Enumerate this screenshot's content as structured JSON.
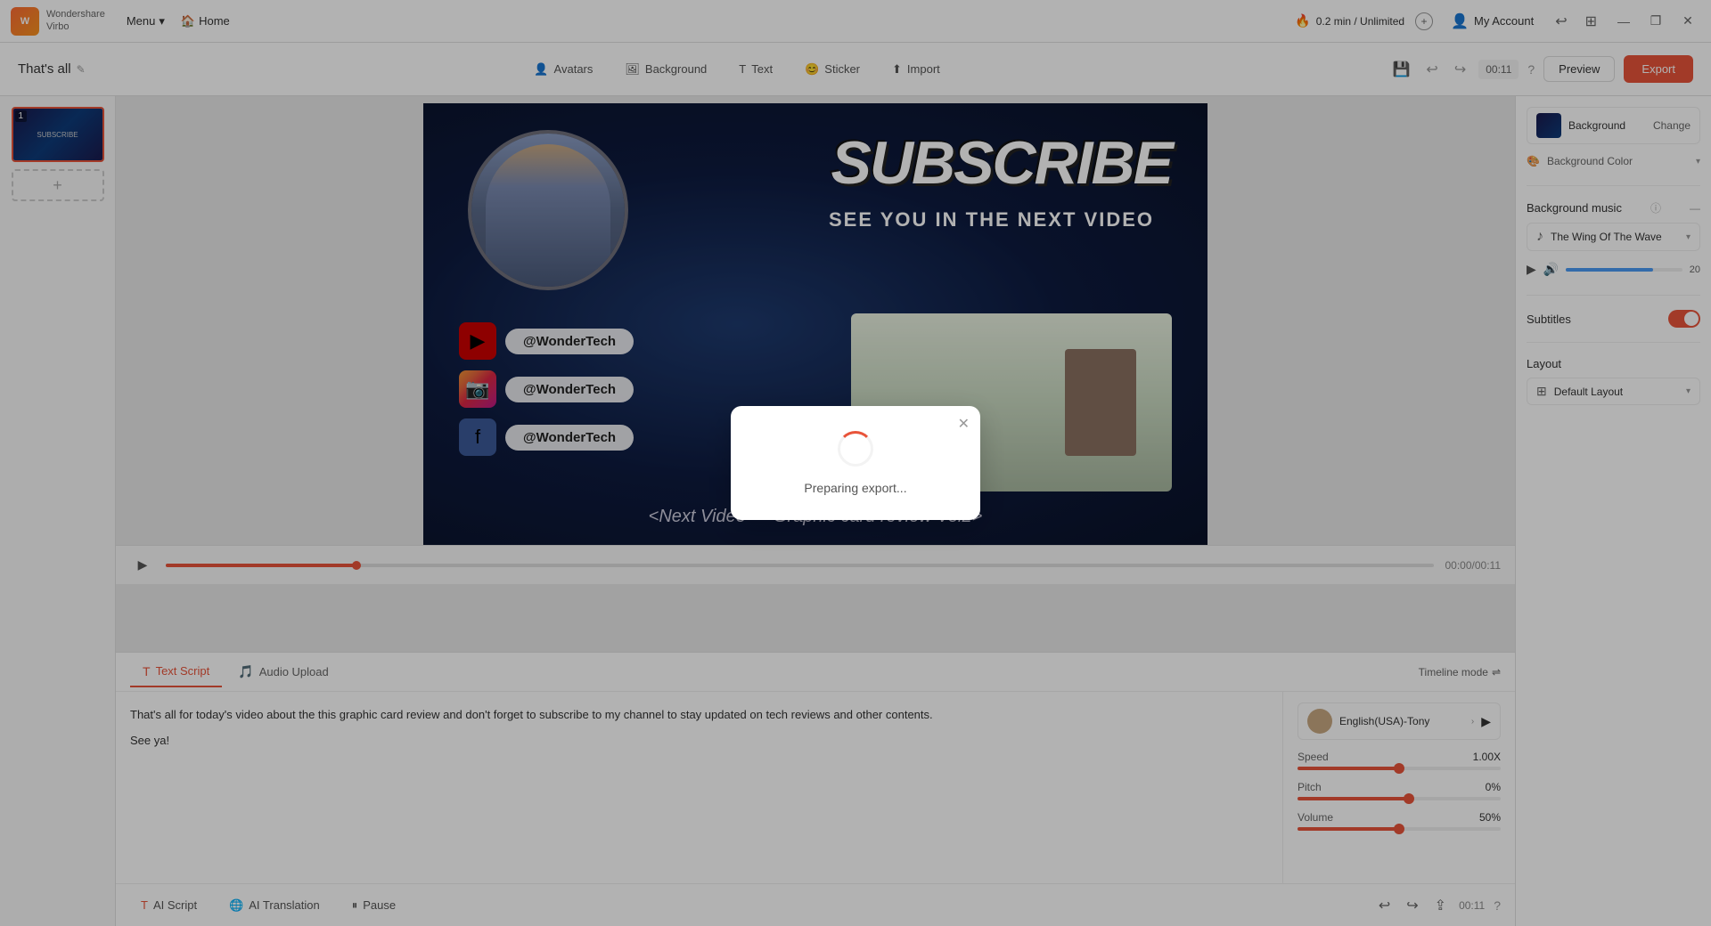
{
  "app": {
    "logo_line1": "Wondershare",
    "logo_line2": "Virbo"
  },
  "topbar": {
    "menu_label": "Menu",
    "home_label": "Home",
    "time_info": "0.2 min / Unlimited",
    "my_account": "My Account",
    "fire_icon": "🔥",
    "plus_label": "+",
    "minimize_label": "—",
    "maximize_label": "❐",
    "close_label": "✕"
  },
  "toolbar": {
    "slide_title": "That's all",
    "edit_icon": "✏️",
    "avatars_label": "Avatars",
    "background_label": "Background",
    "text_label": "Text",
    "sticker_label": "Sticker",
    "import_label": "Import",
    "undo_label": "↩",
    "redo_label": "↪",
    "time_display": "00:11",
    "preview_label": "Preview",
    "export_label": "Export"
  },
  "canvas": {
    "subscribe_text": "SUBSCRIBE",
    "subtitle_text": "SEE YOU IN THE NEXT VIDEO",
    "social_names": [
      "@WonderTech",
      "@WonderTech",
      "@WonderTech"
    ],
    "next_video_text": "<Next Video — Graphic card review Vol2>"
  },
  "timeline": {
    "time_current": "00:00",
    "time_total": "00:11",
    "progress_percent": 15
  },
  "script": {
    "tab_script": "Text Script",
    "tab_audio": "Audio Upload",
    "timeline_mode": "Timeline mode",
    "script_content": "That's all for today's video about the this graphic card review and don't forget to subscribe to my channel to stay updated on tech reviews and other contents.\nSee ya!",
    "voice_name": "English(USA)-Tony",
    "speed_label": "Speed",
    "speed_value": "1.00X",
    "pitch_label": "Pitch",
    "pitch_value": "0%",
    "volume_label": "Volume",
    "volume_value": "50%",
    "ai_script_label": "AI Script",
    "ai_translation_label": "AI Translation",
    "pause_label": "Pause",
    "time_code": "00:11"
  },
  "right_panel": {
    "background_label": "Background",
    "change_label": "Change",
    "bg_color_label": "Background Color",
    "bg_music_label": "Background music",
    "music_name": "The Wing Of The Wave",
    "volume_value": "20",
    "subtitles_label": "Subtitles",
    "layout_label": "Layout",
    "layout_name": "Default Layout"
  },
  "modal": {
    "preparing_text": "Preparing export...",
    "close_label": "✕"
  }
}
